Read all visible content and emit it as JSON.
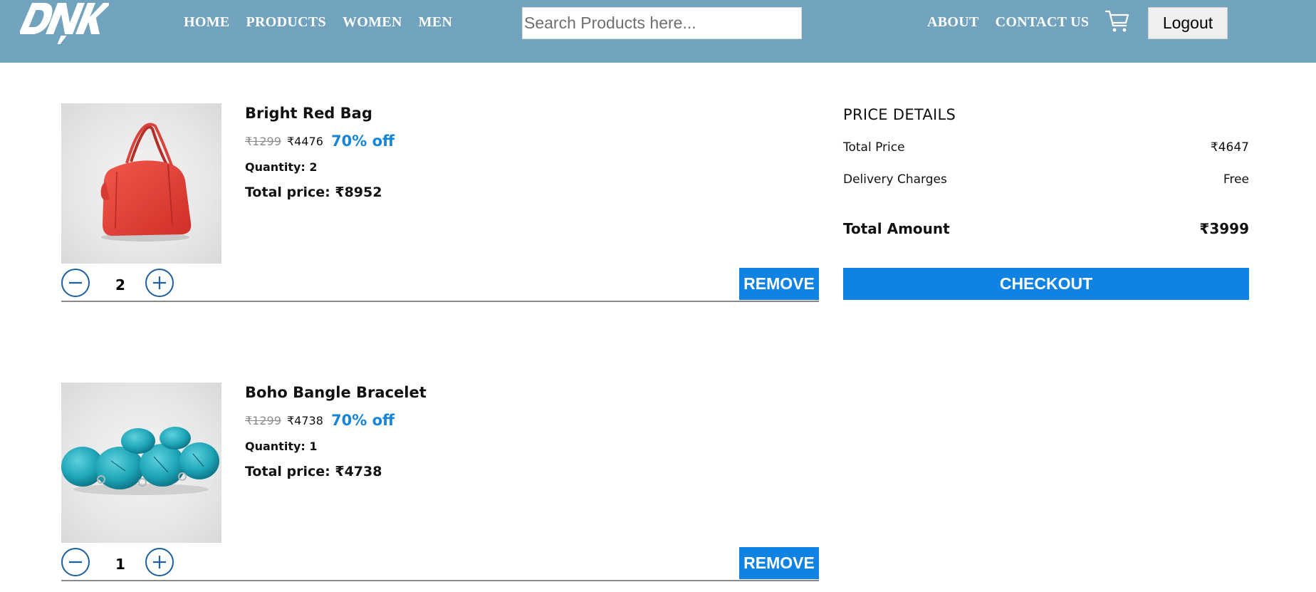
{
  "header": {
    "brand": "DNK",
    "nav_left": [
      "HOME",
      "PRODUCTS",
      "WOMEN",
      "MEN"
    ],
    "search_placeholder": "Search Products here...",
    "nav_right": [
      "ABOUT",
      "CONTACT US"
    ],
    "cart_icon": "shopping-cart-icon",
    "logout_label": "Logout",
    "background_color": "#72a3be"
  },
  "cart": {
    "items": [
      {
        "name": "Bright Red Bag",
        "image_icon": "red-handbag-image",
        "old_price": "₹1299",
        "new_price": "₹4476",
        "discount": "70% off",
        "quantity_label": "Quantity: 2",
        "total_price_label": "Total price: ₹8952",
        "quantity": "2",
        "remove_label": "REMOVE"
      },
      {
        "name": "Boho Bangle Bracelet",
        "image_icon": "turquoise-bracelet-image",
        "old_price": "₹1299",
        "new_price": "₹4738",
        "discount": "70% off",
        "quantity_label": "Quantity: 1",
        "total_price_label": "Total price: ₹4738",
        "quantity": "1",
        "remove_label": "REMOVE"
      }
    ]
  },
  "price_details": {
    "title": "PRICE DETAILS",
    "total_price_label": "Total Price",
    "total_price_value": "₹4647",
    "delivery_label": "Delivery Charges",
    "delivery_value": "Free",
    "total_amount_label": "Total Amount",
    "total_amount_value": "₹3999",
    "checkout_label": "CHECKOUT"
  },
  "colors": {
    "accent": "#0f82e2",
    "discount": "#1684d8",
    "qty_button": "#1b5f9e"
  }
}
